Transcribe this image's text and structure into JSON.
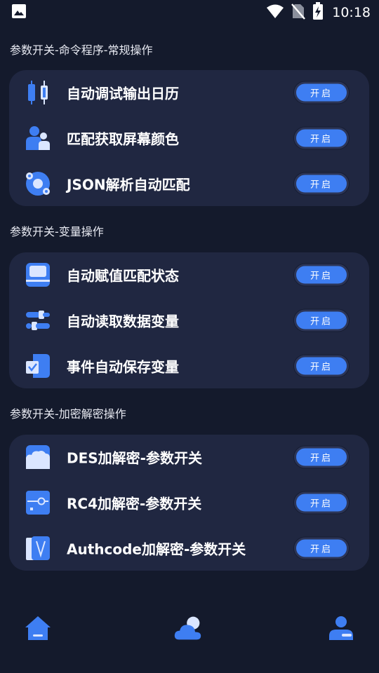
{
  "status_bar": {
    "time": "10:18",
    "icons": [
      "image-icon",
      "wifi-icon",
      "no-sim-icon",
      "battery-charging-icon"
    ]
  },
  "sections": [
    {
      "title": "参数开关-命令程序-常规操作",
      "items": [
        {
          "icon": "candlestick-chart-icon",
          "label": "自动调试输出日历",
          "button": "开启"
        },
        {
          "icon": "users-icon",
          "label": "匹配获取屏幕颜色",
          "button": "开启"
        },
        {
          "icon": "gear-disc-icon",
          "label": "JSON解析自动匹配",
          "button": "开启"
        }
      ]
    },
    {
      "title": "参数开关-变量操作",
      "items": [
        {
          "icon": "laptop-icon",
          "label": "自动赋值匹配状态",
          "button": "开启"
        },
        {
          "icon": "sliders-icon",
          "label": "自动读取数据变量",
          "button": "开启"
        },
        {
          "icon": "checkbox-file-icon",
          "label": "事件自动保存变量",
          "button": "开启"
        }
      ]
    },
    {
      "title": "参数开关-加密解密操作",
      "items": [
        {
          "icon": "cloud-box-icon",
          "label": "DES加解密-参数开关",
          "button": "开启"
        },
        {
          "icon": "key-slider-icon",
          "label": "RC4加解密-参数开关",
          "button": "开启"
        },
        {
          "icon": "v-book-icon",
          "label": "Authcode加解密-参数开关",
          "button": "开启"
        }
      ]
    }
  ],
  "bottom_nav": {
    "items": [
      "home-icon",
      "weather-icon",
      "profile-icon"
    ]
  },
  "colors": {
    "background": "#141a2c",
    "card": "#202741",
    "accent": "#3e7ef2",
    "icon_light": "#dbe6ff"
  }
}
